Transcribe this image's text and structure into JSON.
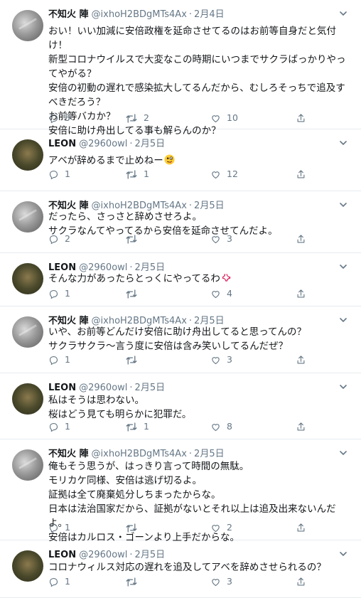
{
  "tweets": [
    {
      "name": "不知火 陣",
      "handle": "@ixhoH2BDgMTs4Ax",
      "date": "2月4日",
      "text": "おい！いい加減に安倍政権を延命させてるのはお前等自身だと気付け！\n新型コロナウイルスで大変なこの時期にいつまでサクラばっかりやってやがる？\n安倍の初動の遅れで感染拡大してるんだから、むしろそっちで追及すべきだろう？\nお前等バカか？\n安倍に助け舟出してる事も解らんのか？",
      "replies": "5",
      "retweets": "2",
      "likes": "10"
    },
    {
      "name": "LEON",
      "handle": "@2960owl",
      "date": "2月5日",
      "text": "アベが辞めるまで止めねー",
      "emoji": "crazy-face",
      "replies": "1",
      "retweets": "1",
      "likes": "12"
    },
    {
      "name": "不知火 陣",
      "handle": "@ixhoH2BDgMTs4Ax",
      "date": "2月5日",
      "text": "だったら、さっさと辞めさせろよ。\nサクラなんてやってるから安倍を延命させてんだよ。",
      "replies": "2",
      "retweets": "",
      "likes": "3"
    },
    {
      "name": "LEON",
      "handle": "@2960owl",
      "date": "2月5日",
      "text": "そんな力があったらとっくにやってるわ",
      "emoji": "anger-symbol",
      "replies": "1",
      "retweets": "",
      "likes": "4"
    },
    {
      "name": "不知火 陣",
      "handle": "@ixhoH2BDgMTs4Ax",
      "date": "2月5日",
      "text": "いや、お前等どんだけ安倍に助け舟出してると思ってんの？\nサクラサクラ〜言う度に安倍は含み笑いしてるんだぜ？",
      "replies": "1",
      "retweets": "",
      "likes": "3"
    },
    {
      "name": "LEON",
      "handle": "@2960owl",
      "date": "2月5日",
      "text": "私はそうは思わない。\n桜はどう見ても明らかに犯罪だ。",
      "replies": "1",
      "retweets": "1",
      "likes": "8"
    },
    {
      "name": "不知火 陣",
      "handle": "@ixhoH2BDgMTs4Ax",
      "date": "2月5日",
      "text": "俺もそう思うが、はっきり言って時間の無駄。\nモリカケ同様、安倍は逃げ切るよ。\n証拠は全て廃棄処分しちまったからな。\n日本は法治国家だから、証拠がないとそれ以上は追及出来ないんだよ。\n安倍はカルロス・ゴーンより上手だからな。",
      "replies": "1",
      "retweets": "",
      "likes": "2"
    },
    {
      "name": "LEON",
      "handle": "@2960owl",
      "date": "2月5日",
      "text": "コロナウィルス対応の遅れを追及してアベを辞めさせられるの？",
      "replies": "1",
      "retweets": "",
      "likes": "3"
    }
  ],
  "colors": {
    "text": "#14171a",
    "muted": "#657786",
    "divider": "#e6ecf0"
  }
}
